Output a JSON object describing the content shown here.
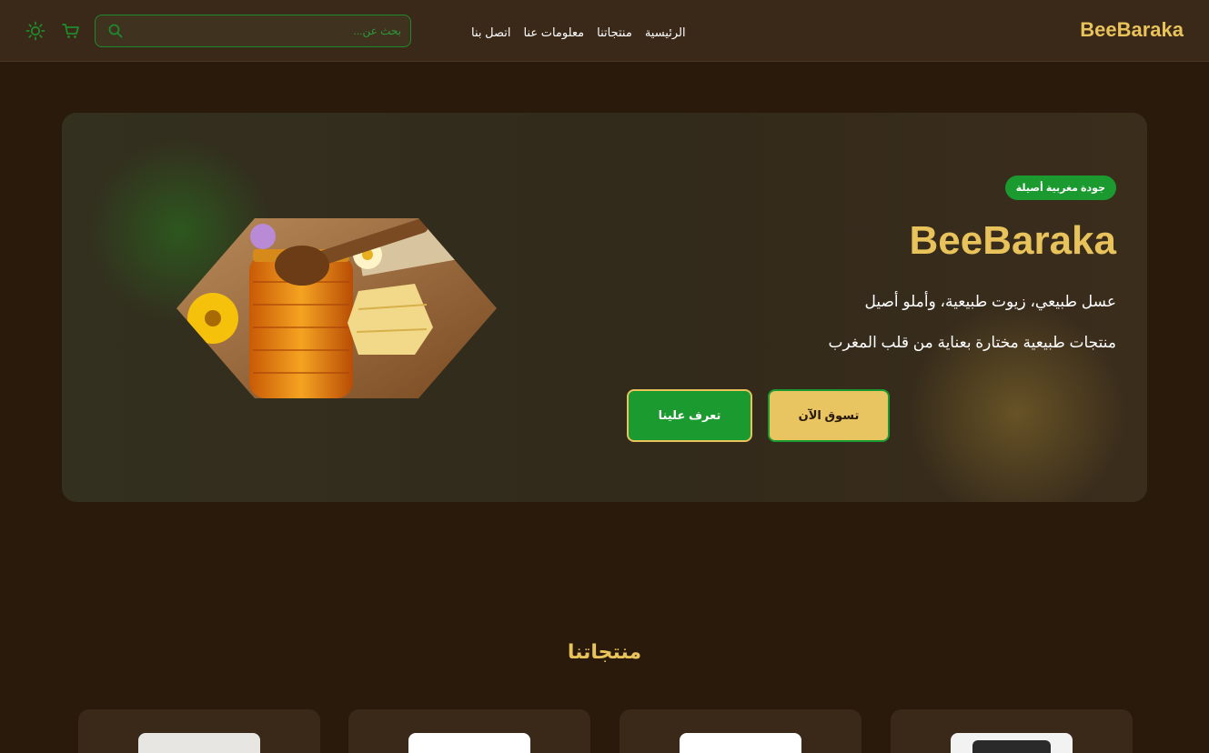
{
  "navbar": {
    "brand": "BeeBaraka",
    "links": [
      "الرئيسية",
      "منتجاتنا",
      "معلومات عنا",
      "اتصل بنا"
    ],
    "search_placeholder": "بحث عن..."
  },
  "hero": {
    "badge": "جودة مغربية أصيلة",
    "title": "BeeBaraka",
    "subtitle_1": "عسل طبيعي، زيوت طبيعية، وأملو أصيل",
    "subtitle_2": "منتجات طبيعية مختارة بعناية من قلب المغرب",
    "shop_button": "تسوق الآن",
    "about_button": "تعرف علينا"
  },
  "products": {
    "title": "منتجاتنا"
  },
  "colors": {
    "background": "#2a1a0c",
    "navbar": "#3a2818",
    "gold": "#e8c25a",
    "green": "#1a9a2f"
  },
  "icons": [
    "search-icon",
    "cart-icon",
    "sun-icon"
  ]
}
